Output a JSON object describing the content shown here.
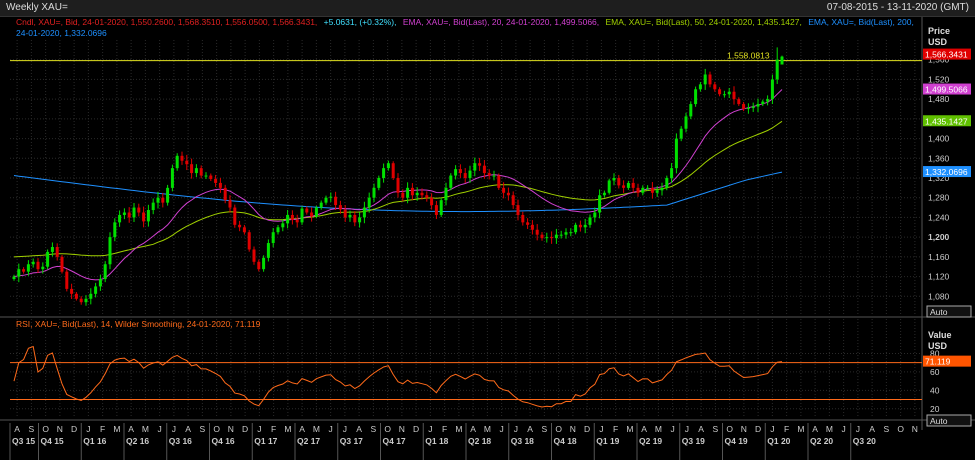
{
  "window": {
    "title": "Weekly XAU=",
    "date_range": "07-08-2015 - 13-11-2020 (GMT)"
  },
  "legend": {
    "line1_cndl": "Cndl, XAU=, Bid, 24-01-2020, 1,550.2600, 1,568.3510, 1,556.0500, 1,566.3431,",
    "line1_change": "+5.0631, (+0.32%),",
    "line1_ema20": "EMA, XAU=, Bid(Last), 20, 24-01-2020, 1,499.5066,",
    "line1_ema50": "EMA, XAU=, Bid(Last), 50, 24-01-2020, 1,435.1427,",
    "line1_ema200": "EMA, XAU=, Bid(Last), 200,",
    "line2_ema200": "24-01-2020, 1,332.0696",
    "rsi": "RSI, XAU=, Bid(Last), 14, Wilder Smoothing, 24-01-2020, 71.119"
  },
  "price_axis": {
    "title": "Price",
    "unit": "USD",
    "ticks": [
      "1,560",
      "1,520",
      "1,480",
      "1,440",
      "1,400",
      "1,360",
      "1,320",
      "1,280",
      "1,240",
      "1,200",
      "1,160",
      "1,120",
      "1,080"
    ],
    "tick_values": [
      1560,
      1520,
      1480,
      1440,
      1400,
      1360,
      1320,
      1280,
      1240,
      1200,
      1160,
      1120,
      1080
    ],
    "bold_ticks": [
      "1,200"
    ],
    "auto_label": "Auto"
  },
  "rsi_axis": {
    "title": "Value",
    "unit": "USD",
    "ticks": [
      "80",
      "60",
      "40",
      "20"
    ],
    "tick_values": [
      80,
      60,
      40,
      20
    ],
    "auto_label": "Auto"
  },
  "badges": {
    "last": "1,566.3431",
    "ema20": "1,499.5066",
    "ema50": "1,435.1427",
    "ema200": "1,332.0696",
    "rsi": "71.119"
  },
  "annotation": {
    "label": "1,558.0813",
    "value": 1558.0813
  },
  "rsi_levels": [
    70,
    30
  ],
  "x_axis": {
    "months": [
      "A",
      "S",
      "O",
      "N",
      "D",
      "J",
      "F",
      "M",
      "A",
      "M",
      "J",
      "J",
      "A",
      "S",
      "O",
      "N",
      "D",
      "J",
      "F",
      "M",
      "A",
      "M",
      "J",
      "J",
      "A",
      "S",
      "O",
      "N",
      "D",
      "J",
      "F",
      "M",
      "A",
      "M",
      "J",
      "J",
      "A",
      "S",
      "O",
      "N",
      "D",
      "J",
      "F",
      "M",
      "A",
      "M",
      "J",
      "J",
      "A",
      "S",
      "O",
      "N",
      "D",
      "J",
      "F",
      "M",
      "A",
      "M",
      "J",
      "J",
      "A",
      "S",
      "O",
      "N"
    ],
    "quarters": [
      "Q3 15",
      "Q4 15",
      "Q1 16",
      "Q2 16",
      "Q3 16",
      "Q4 16",
      "Q1 17",
      "Q2 17",
      "Q3 17",
      "Q4 17",
      "Q1 18",
      "Q2 18",
      "Q3 18",
      "Q4 18",
      "Q1 19",
      "Q2 19",
      "Q3 19",
      "Q4 19",
      "Q1 20",
      "Q2 20",
      "Q3 20"
    ]
  },
  "colors": {
    "up": "#00e000",
    "down": "#e00000",
    "ema20": "#d040d0",
    "ema50": "#a0d000",
    "ema200": "#1e90ff",
    "rsi": "#ff6a1a",
    "annot": "#e0e020"
  },
  "chart_data": [
    {
      "type": "candlestick",
      "title": "Weekly XAU=",
      "ylabel": "Price USD",
      "ylim": [
        1040,
        1600
      ],
      "grid": true,
      "x_range": [
        "07-08-2015",
        "13-11-2020"
      ],
      "last_date": "24-01-2020",
      "last_ohlc": [
        1550.26,
        1568.351,
        1556.05,
        1566.3431
      ],
      "weekly_close_approx": [
        1120,
        1135,
        1130,
        1145,
        1150,
        1135,
        1140,
        1170,
        1180,
        1160,
        1130,
        1095,
        1085,
        1075,
        1068,
        1075,
        1085,
        1100,
        1115,
        1145,
        1200,
        1230,
        1245,
        1250,
        1240,
        1260,
        1250,
        1232,
        1255,
        1270,
        1280,
        1270,
        1300,
        1340,
        1365,
        1355,
        1348,
        1330,
        1340,
        1325,
        1325,
        1318,
        1310,
        1300,
        1275,
        1260,
        1225,
        1220,
        1210,
        1175,
        1150,
        1135,
        1158,
        1188,
        1210,
        1220,
        1228,
        1245,
        1235,
        1230,
        1258,
        1250,
        1242,
        1260,
        1270,
        1280,
        1282,
        1265,
        1256,
        1240,
        1245,
        1230,
        1240,
        1260,
        1280,
        1300,
        1320,
        1340,
        1350,
        1320,
        1290,
        1280,
        1300,
        1285,
        1290,
        1285,
        1280,
        1265,
        1245,
        1275,
        1300,
        1325,
        1338,
        1330,
        1320,
        1335,
        1350,
        1345,
        1330,
        1325,
        1325,
        1300,
        1290,
        1285,
        1265,
        1245,
        1230,
        1225,
        1215,
        1205,
        1198,
        1200,
        1198,
        1205,
        1205,
        1210,
        1210,
        1225,
        1220,
        1225,
        1240,
        1250,
        1285,
        1290,
        1315,
        1320,
        1305,
        1300,
        1310,
        1300,
        1290,
        1300,
        1300,
        1290,
        1295,
        1300,
        1320,
        1340,
        1400,
        1420,
        1445,
        1470,
        1500,
        1510,
        1530,
        1510,
        1500,
        1490,
        1490,
        1495,
        1480,
        1470,
        1460,
        1462,
        1465,
        1470,
        1475,
        1480,
        1520,
        1560,
        1566
      ]
    },
    {
      "type": "line",
      "series": [
        {
          "name": "EMA 20",
          "last_value": 1499.5066
        },
        {
          "name": "EMA 50",
          "last_value": 1435.1427
        },
        {
          "name": "EMA 200",
          "last_value": 1332.0696
        }
      ]
    },
    {
      "type": "line",
      "title": "RSI, XAU=, Bid(Last), 14, Wilder Smoothing",
      "ylim": [
        10,
        100
      ],
      "levels": [
        70,
        30
      ],
      "series": [
        {
          "name": "RSI 14",
          "last_value": 71.119
        }
      ]
    }
  ]
}
